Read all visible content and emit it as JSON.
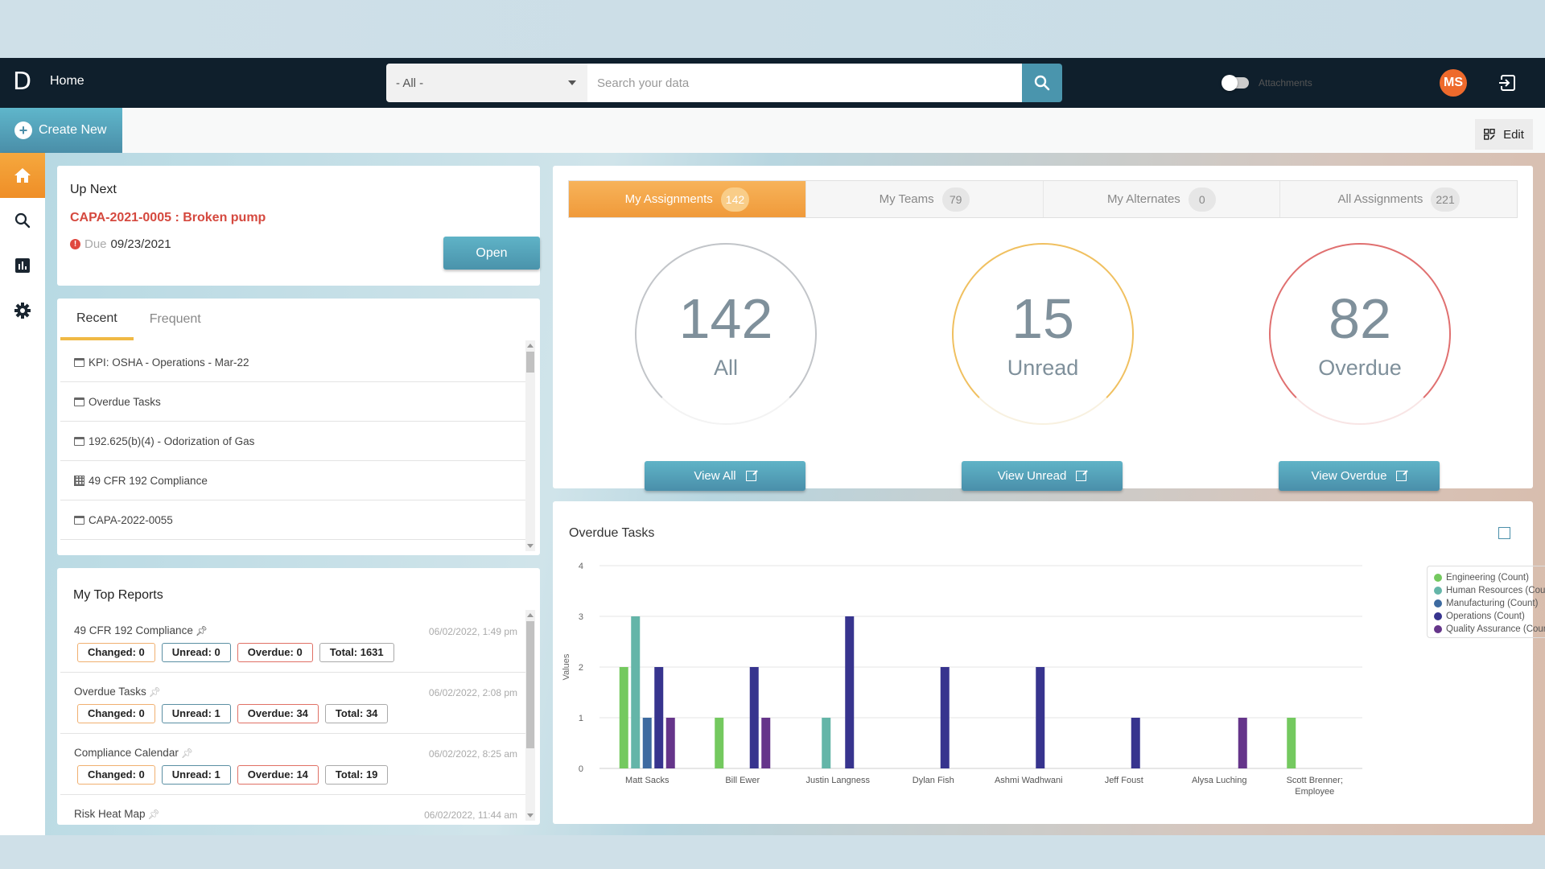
{
  "header": {
    "logo": "D",
    "title": "Home",
    "scope_select": "- All -",
    "search_placeholder": "Search your data",
    "attachments_label": "Attachments",
    "attachments_toggle": false,
    "avatar_initials": "MS"
  },
  "toolbar": {
    "create_label": "Create New",
    "edit_label": "Edit"
  },
  "sidebar": {
    "items": [
      {
        "name": "home",
        "icon": "home-icon",
        "active": true
      },
      {
        "name": "search",
        "icon": "search-icon",
        "active": false
      },
      {
        "name": "reports",
        "icon": "chart-icon",
        "active": false
      },
      {
        "name": "settings",
        "icon": "gear-icon",
        "active": false
      }
    ]
  },
  "up_next": {
    "title": "Up Next",
    "item": "CAPA-2021-0005 : Broken pump",
    "due_label": "Due",
    "due_date": "09/23/2021",
    "open_label": "Open"
  },
  "recent": {
    "tabs": [
      "Recent",
      "Frequent"
    ],
    "active_tab": "Recent",
    "items": [
      {
        "label": "KPI: OSHA - Operations - Mar-22",
        "icon": "form-icon"
      },
      {
        "label": "Overdue Tasks",
        "icon": "calendar-icon"
      },
      {
        "label": "192.625(b)(4) - Odorization of Gas",
        "icon": "form-icon"
      },
      {
        "label": "49 CFR 192 Compliance",
        "icon": "grid-icon"
      },
      {
        "label": "CAPA-2022-0055",
        "icon": "form-icon"
      }
    ]
  },
  "top_reports": {
    "title": "My Top Reports",
    "items": [
      {
        "name": "49 CFR 192 Compliance",
        "pinned": true,
        "date": "06/02/2022, 1:49 pm",
        "changed": "Changed: 0",
        "unread": "Unread: 0",
        "overdue": "Overdue: 0",
        "total": "Total: 1631"
      },
      {
        "name": "Overdue Tasks",
        "pinned": false,
        "date": "06/02/2022, 2:08 pm",
        "changed": "Changed: 0",
        "unread": "Unread: 1",
        "overdue": "Overdue: 34",
        "total": "Total: 34"
      },
      {
        "name": "Compliance Calendar",
        "pinned": false,
        "date": "06/02/2022, 8:25 am",
        "changed": "Changed: 0",
        "unread": "Unread: 1",
        "overdue": "Overdue: 14",
        "total": "Total: 19"
      },
      {
        "name": "Risk Heat Map",
        "pinned": false,
        "date": "06/02/2022, 11:44 am"
      }
    ]
  },
  "assignments": {
    "tabs": [
      {
        "label": "My Assignments",
        "count": "142",
        "active": true
      },
      {
        "label": "My Teams",
        "count": "79",
        "active": false
      },
      {
        "label": "My Alternates",
        "count": "0",
        "active": false
      },
      {
        "label": "All Assignments",
        "count": "221",
        "active": false
      }
    ],
    "stats": [
      {
        "value": "142",
        "label": "All",
        "button": "View All"
      },
      {
        "value": "15",
        "label": "Unread",
        "button": "View Unread"
      },
      {
        "value": "82",
        "label": "Overdue",
        "button": "View Overdue"
      }
    ]
  },
  "overdue_panel": {
    "title": "Overdue Tasks"
  },
  "chart_data": {
    "type": "bar",
    "title": "Overdue Tasks",
    "xlabel": "",
    "ylabel": "Values",
    "ylim": [
      0,
      4
    ],
    "yticks": [
      0,
      1,
      2,
      3,
      4
    ],
    "grid": true,
    "legend_position": "top-right",
    "categories": [
      "Matt Sacks",
      "Bill Ewer",
      "Justin Langness",
      "Dylan Fish",
      "Ashmi Wadhwani",
      "Jeff Foust",
      "Alysa Luching",
      "Scott Brenner; Employee"
    ],
    "series": [
      {
        "name": "Engineering (Count)",
        "color": "#74c95f",
        "values": [
          2,
          1,
          0,
          0,
          0,
          0,
          0,
          1
        ]
      },
      {
        "name": "Human Resources (Count)",
        "color": "#64b5a8",
        "values": [
          3,
          0,
          1,
          0,
          0,
          0,
          0,
          0
        ]
      },
      {
        "name": "Manufacturing (Count)",
        "color": "#3d6aa0",
        "values": [
          1,
          0,
          0,
          0,
          0,
          0,
          0,
          0
        ]
      },
      {
        "name": "Operations (Count)",
        "color": "#37348e",
        "values": [
          2,
          2,
          3,
          2,
          2,
          1,
          0,
          0
        ]
      },
      {
        "name": "Quality Assurance (Count)",
        "color": "#65358a",
        "values": [
          1,
          1,
          0,
          0,
          0,
          0,
          1,
          0
        ]
      }
    ]
  },
  "colors": {
    "header_bg": "#0f1f2c",
    "accent_orange": "#f09a3a",
    "accent_teal": "#4a93ab",
    "alert_red": "#d5493f"
  }
}
